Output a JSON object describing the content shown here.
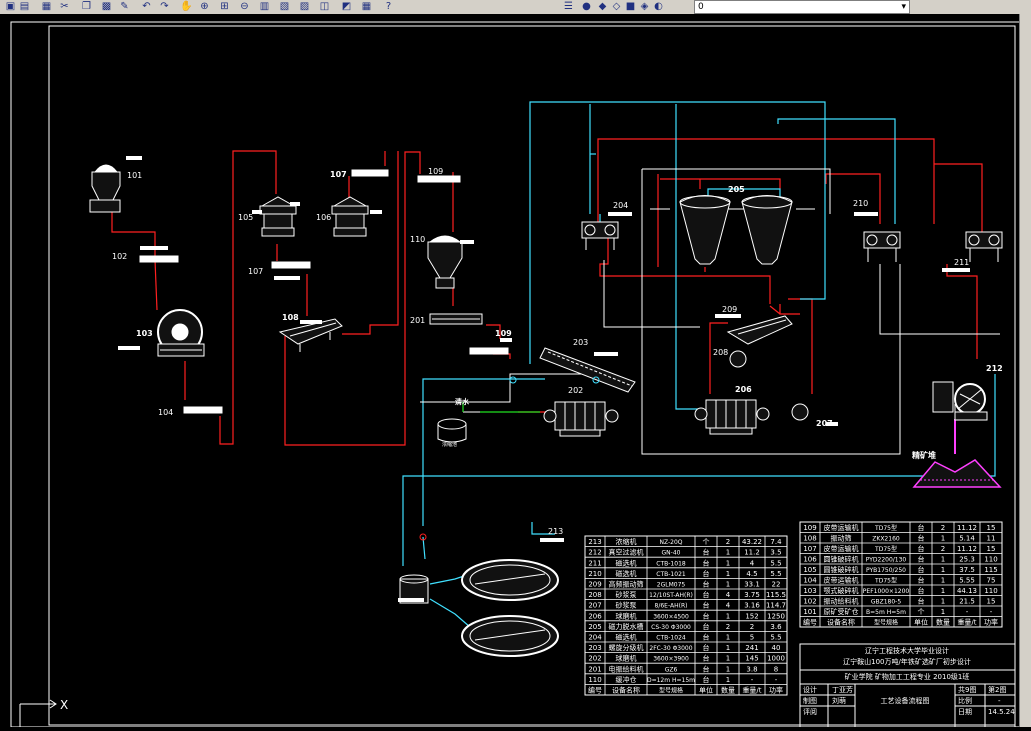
{
  "toolbar": {
    "layer_value": "0",
    "icons": [
      "open-icon",
      "save-icon",
      "plot-icon",
      "cut-icon",
      "copy-icon",
      "paste-icon",
      "match-icon",
      "undo-icon",
      "redo-icon",
      "pan-icon",
      "zoom-realtime-icon",
      "zoom-window-icon",
      "zoom-previous-icon",
      "properties-icon",
      "design-center-icon",
      "tool-palette-icon",
      "sheet-set-icon",
      "markup-icon",
      "calc-icon",
      "help-icon",
      "layer-manager-icon",
      "layer-on-icon",
      "layer-freeze-icon",
      "layer-lock-icon",
      "layer-color-icon",
      "layer-state-icon",
      "layer-previous-icon"
    ]
  },
  "labels": {
    "n101": "101",
    "n102": "102",
    "n103": "103",
    "n104": "104",
    "n105": "105",
    "n106": "106",
    "n107a": "107",
    "n107b": "107",
    "n108": "108",
    "n109a": "109",
    "n109b": "109",
    "n110": "110",
    "n201": "201",
    "n202": "202",
    "n203": "203",
    "n204": "204",
    "n205": "205",
    "n206": "206",
    "n207": "207",
    "n208": "208",
    "n209": "209",
    "n210": "210",
    "n211": "211",
    "n212": "212",
    "n213": "213",
    "water": "清水",
    "thickener_note": "浓缩池",
    "concentrate": "精矿堆"
  },
  "table_right": {
    "rows": [
      [
        "109",
        "皮带运输机",
        "TD75型",
        "台",
        "2",
        "11.12",
        "15"
      ],
      [
        "108",
        "振动筛",
        "ZKX2160",
        "台",
        "1",
        "5.14",
        "11"
      ],
      [
        "107",
        "皮带运输机",
        "TD75型",
        "台",
        "2",
        "11.12",
        "15"
      ],
      [
        "106",
        "圆锥破碎机",
        "PYD2200/130",
        "台",
        "1",
        "25.3",
        "110"
      ],
      [
        "105",
        "圆锥破碎机",
        "PYB1750/250",
        "台",
        "1",
        "37.5",
        "115"
      ],
      [
        "104",
        "皮带运输机",
        "TD75型",
        "台",
        "1",
        "5.55",
        "75"
      ],
      [
        "103",
        "颚式破碎机",
        "PEF1000×1200",
        "台",
        "1",
        "44.13",
        "110"
      ],
      [
        "102",
        "振动给料机",
        "GBZ180-5",
        "台",
        "1",
        "21.5",
        "15"
      ],
      [
        "101",
        "原矿受矿仓",
        "B=5m H=5m",
        "个",
        "1",
        "-",
        "-"
      ]
    ],
    "header": [
      "编号",
      "设备名称",
      "型号规格",
      "单位",
      "数量",
      "重量/t",
      "功率"
    ]
  },
  "table_left": {
    "rows": [
      [
        "213",
        "浓缩机",
        "NZ-20Q",
        "个",
        "2",
        "43.22",
        "7.4"
      ],
      [
        "212",
        "真空过滤机",
        "GN-40",
        "台",
        "1",
        "11.2",
        "3.5"
      ],
      [
        "211",
        "磁选机",
        "CTB-1018",
        "台",
        "1",
        "4",
        "5.5"
      ],
      [
        "210",
        "磁选机",
        "CTB-1021",
        "台",
        "1",
        "4.5",
        "5.5"
      ],
      [
        "209",
        "高频振动筛",
        "2GLM075",
        "台",
        "1",
        "33.1",
        "22"
      ],
      [
        "208",
        "砂浆泵",
        "12/10ST-AH(R)",
        "台",
        "4",
        "3.75",
        "115.5"
      ],
      [
        "207",
        "砂浆泵",
        "8/6E-AH(R)",
        "台",
        "4",
        "3.16",
        "114.7"
      ],
      [
        "206",
        "球磨机",
        "3600×4500",
        "台",
        "1",
        "152",
        "1250"
      ],
      [
        "205",
        "磁力脱水槽",
        "CS-30 Φ3000",
        "台",
        "2",
        "2",
        "3.6"
      ],
      [
        "204",
        "磁选机",
        "CTB-1024",
        "台",
        "1",
        "5",
        "5.5"
      ],
      [
        "203",
        "螺旋分级机",
        "2FC-30 Φ3000",
        "台",
        "1",
        "241",
        "40"
      ],
      [
        "202",
        "球磨机",
        "3600×3900",
        "台",
        "1",
        "145",
        "1000"
      ],
      [
        "201",
        "电振给料机",
        "GZ6",
        "台",
        "1",
        "3.8",
        "8"
      ],
      [
        "110",
        "缓冲仓",
        "D=12m H=15m",
        "台",
        "1",
        "-",
        "-"
      ]
    ],
    "header": [
      "编号",
      "设备名称",
      "型号规格",
      "单位",
      "数量",
      "重量/t",
      "功率"
    ]
  },
  "title_block": {
    "school": "辽宁工程技术大学毕业设计",
    "project": "辽宁鞍山100万吨/年铁矿选矿厂初步设计",
    "dept": "矿业学院 矿物加工工程专业 2010级1班",
    "design": "设计",
    "design_name": "丁亚芳",
    "draw": "制图",
    "draw_name": "刘萌",
    "review": "评阅",
    "drawing_title": "工艺设备流程图",
    "sheet_label": "共9图",
    "sheet_no": "第2图",
    "scale_label": "比例",
    "scale_value": "-",
    "date_label": "日期",
    "date_value": "14.5.24"
  },
  "colors": {
    "flow_red": "#ff2020",
    "flow_cyan": "#40e0ff",
    "line_white": "#ffffff",
    "flow_green": "#20e020",
    "flow_magenta": "#ff40ff"
  }
}
